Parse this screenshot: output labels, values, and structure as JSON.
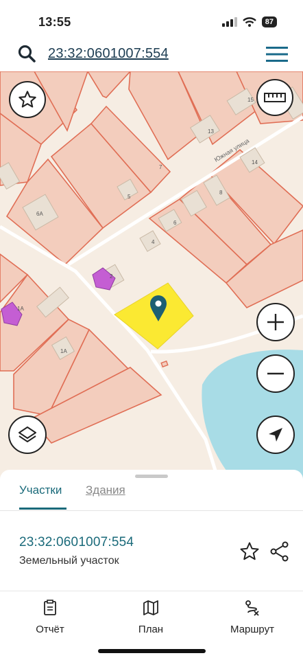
{
  "status": {
    "time": "13:55",
    "battery": "87"
  },
  "search": {
    "query": "23:32:0601007:554"
  },
  "map": {
    "parcel_labels": [
      "15",
      "13",
      "14",
      "7",
      "5",
      "6А",
      "8",
      "6",
      "4",
      "2",
      "1А",
      "1А"
    ],
    "street_label": "Южная улица",
    "colors": {
      "land": "#f6ede3",
      "parcel_fill": "#f3cdbd",
      "parcel_stroke": "#e06e55",
      "selected": "#fbe932",
      "water": "#a8dce6",
      "pin": "#1d5f73",
      "building": "#e9e0d4",
      "purple": "#c45ed3"
    }
  },
  "sheet": {
    "tabs": [
      {
        "label": "Участки"
      },
      {
        "label": "Здания"
      }
    ],
    "result": {
      "number": "23:32:0601007:554",
      "type": "Земельный участок"
    }
  },
  "nav": [
    {
      "label": "Отчёт",
      "icon": "report-icon"
    },
    {
      "label": "План",
      "icon": "map-icon"
    },
    {
      "label": "Маршрут",
      "icon": "route-icon"
    }
  ]
}
